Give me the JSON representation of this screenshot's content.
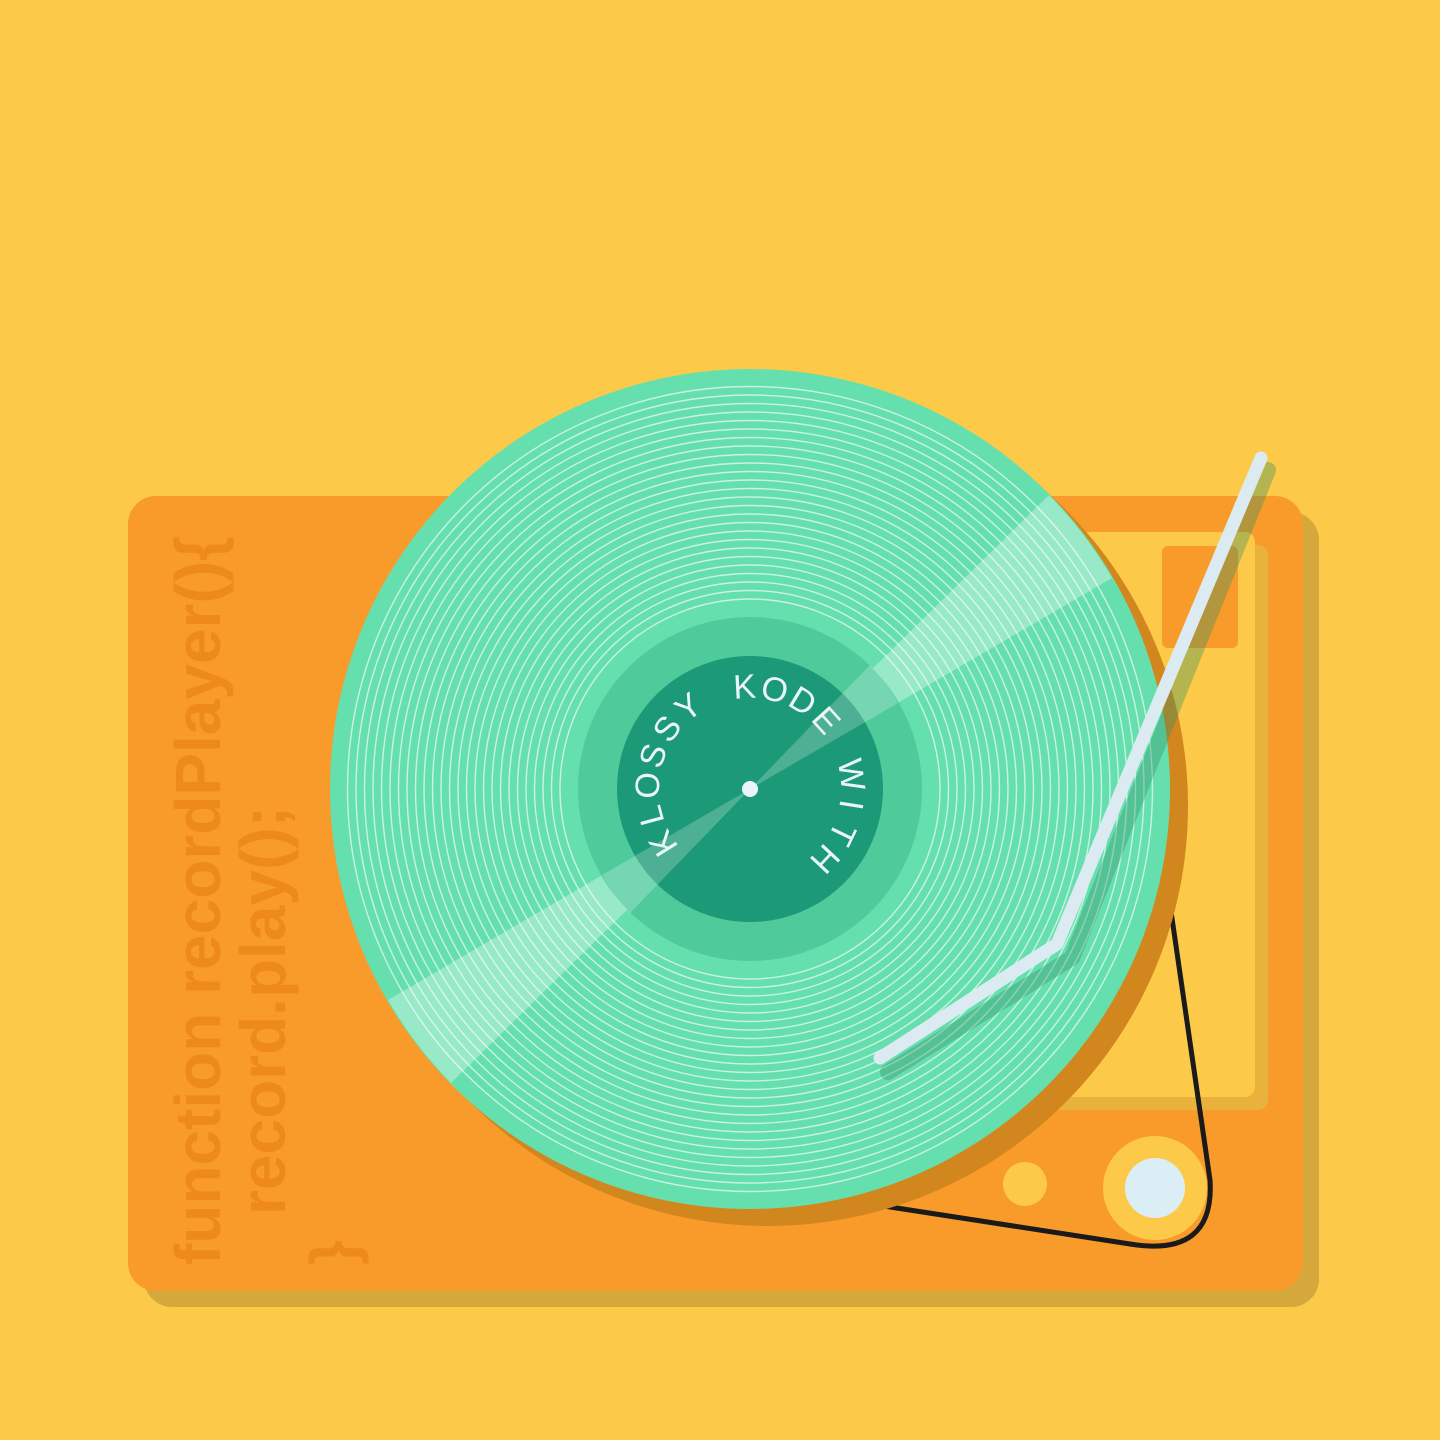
{
  "code": {
    "line1": "function recordPlayer(){",
    "line2": "record.play();",
    "line3": "}"
  },
  "record": {
    "label_text": "KLOSSY KODE WITH"
  },
  "colors": {
    "background": "#FCCA48",
    "player_body": "#F99B2A",
    "player_shadow": "#D4A83A",
    "vinyl": "#66DFAE",
    "label_ring": "#4FCB9B",
    "label": "#1C9A78",
    "tonearm": "#DCEAF2",
    "belt": "#1A1A1A"
  }
}
